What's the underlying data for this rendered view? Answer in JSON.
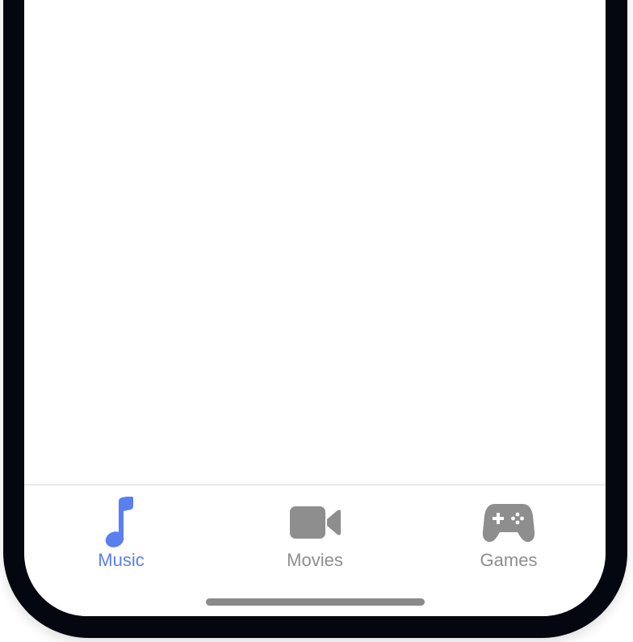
{
  "theme": {
    "active_color": "#5b7ff0",
    "inactive_color": "#8e8e8e",
    "frame_color": "#04070f"
  },
  "tab_bar": {
    "tabs": [
      {
        "label": "Music",
        "icon": "music-note-icon",
        "active": true
      },
      {
        "label": "Movies",
        "icon": "video-camera-icon",
        "active": false
      },
      {
        "label": "Games",
        "icon": "gamepad-icon",
        "active": false
      }
    ]
  }
}
